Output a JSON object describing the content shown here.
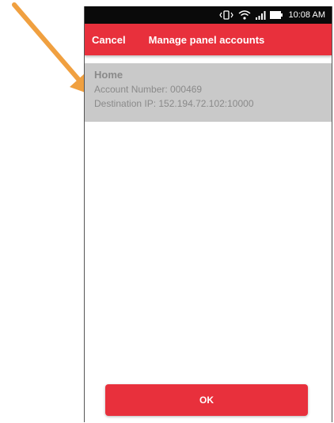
{
  "status_bar": {
    "time": "10:08 AM",
    "icons": [
      "vibrate-icon",
      "wifi-icon",
      "signal-icon",
      "battery-icon"
    ]
  },
  "toolbar": {
    "cancel_label": "Cancel",
    "title": "Manage panel accounts"
  },
  "accounts": [
    {
      "name": "Home",
      "account_number": "Account Number: 000469",
      "destination_ip": "Destination IP: 152.194.72.102:10000"
    }
  ],
  "ok_label": "OK",
  "colors": {
    "accent": "#e8303c",
    "status_bar": "#0a0a0a",
    "selected_row": "#c9c9c9",
    "annotation_arrow": "#f0a040"
  }
}
